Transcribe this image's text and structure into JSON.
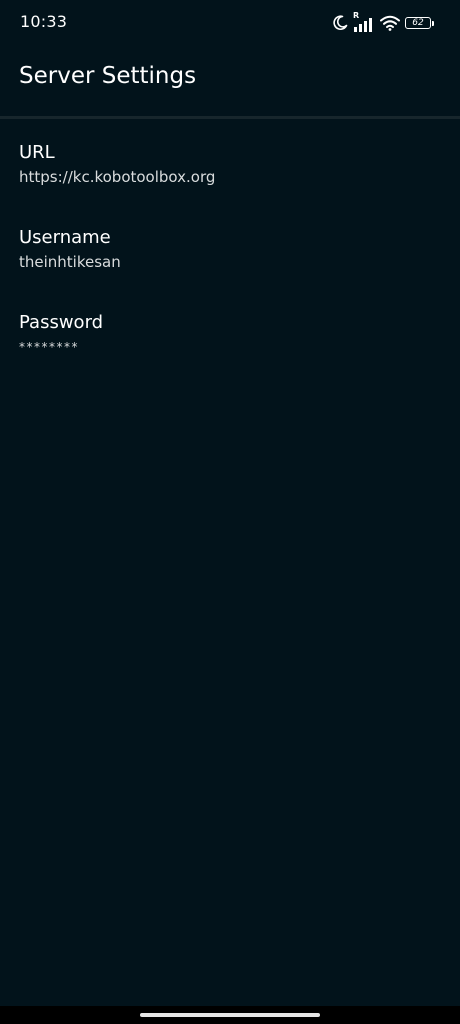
{
  "status_bar": {
    "time": "10:33",
    "icons": [
      "moon-icon",
      "signal-icon",
      "wifi-icon",
      "battery-icon"
    ],
    "signal_badge": "R",
    "battery_level": "62"
  },
  "app_bar": {
    "title": "Server Settings"
  },
  "preferences": [
    {
      "title": "URL",
      "summary": "https://kc.kobotoolbox.org"
    },
    {
      "title": "Username",
      "summary": "theinhtikesan"
    },
    {
      "title": "Password",
      "summary": "********"
    }
  ],
  "colors": {
    "background": "#02131b",
    "divider": "#17262c",
    "text_primary": "#ffffff",
    "text_secondary": "#d9dcdd"
  }
}
